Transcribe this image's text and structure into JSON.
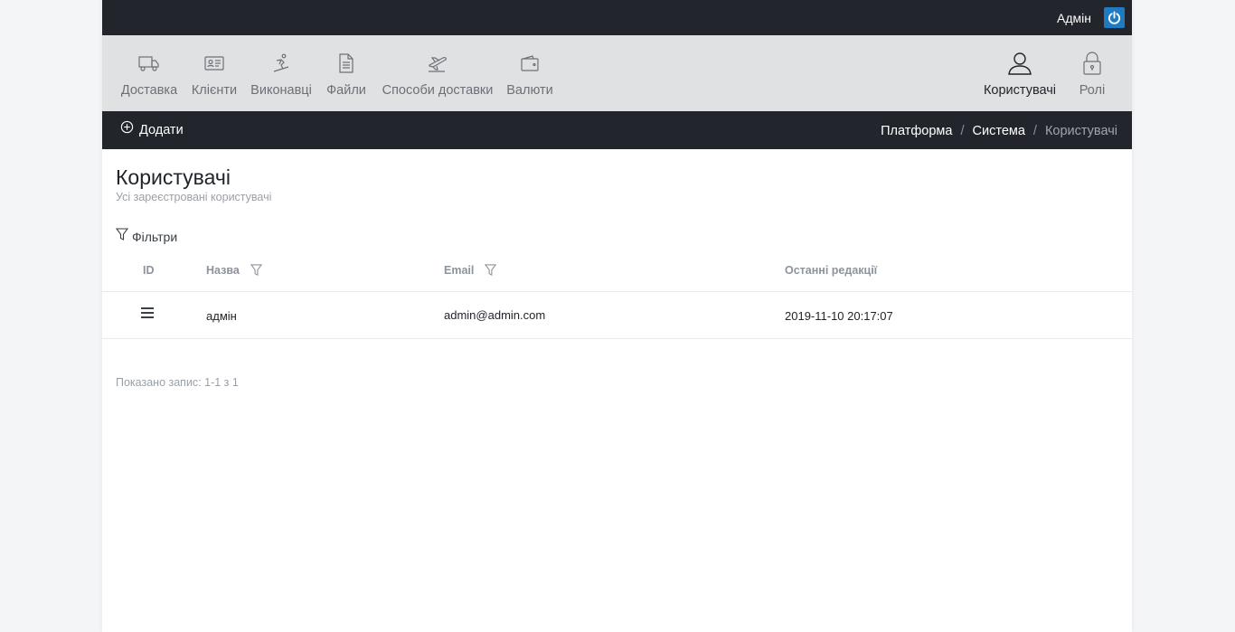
{
  "header": {
    "user_name": "Адмін"
  },
  "nav": {
    "items": [
      {
        "label": "Доставка",
        "icon": "truck-icon"
      },
      {
        "label": "Клієнти",
        "icon": "id-card-icon"
      },
      {
        "label": "Виконавці",
        "icon": "snowboarder-icon"
      },
      {
        "label": "Файли",
        "icon": "document-icon"
      },
      {
        "label": "Способи доставки",
        "icon": "plane-icon"
      },
      {
        "label": "Валюти",
        "icon": "wallet-icon"
      }
    ],
    "right_items": [
      {
        "label": "Користувачі",
        "icon": "user-icon",
        "active": true
      },
      {
        "label": "Ролі",
        "icon": "lock-icon"
      }
    ]
  },
  "actions": {
    "add_label": "Додати"
  },
  "breadcrumb": {
    "items": [
      "Платформа",
      "Система"
    ],
    "current": "Користувачі"
  },
  "page": {
    "title": "Користувачі",
    "subtitle": "Усі зареєстровані користувачі",
    "filters_label": "Фільтри"
  },
  "table": {
    "columns": [
      "ID",
      "Назва",
      "Email",
      "Останні редакції"
    ],
    "rows": [
      {
        "name": "адмін",
        "email": "admin@admin.com",
        "updated": "2019-11-10 20:17:07"
      }
    ]
  },
  "pagination": {
    "info": "Показано запис: 1-1 з 1"
  },
  "colors": {
    "dark": "#22262c",
    "nav_bg": "#e0e1e3",
    "accent": "#1f7bc1"
  }
}
